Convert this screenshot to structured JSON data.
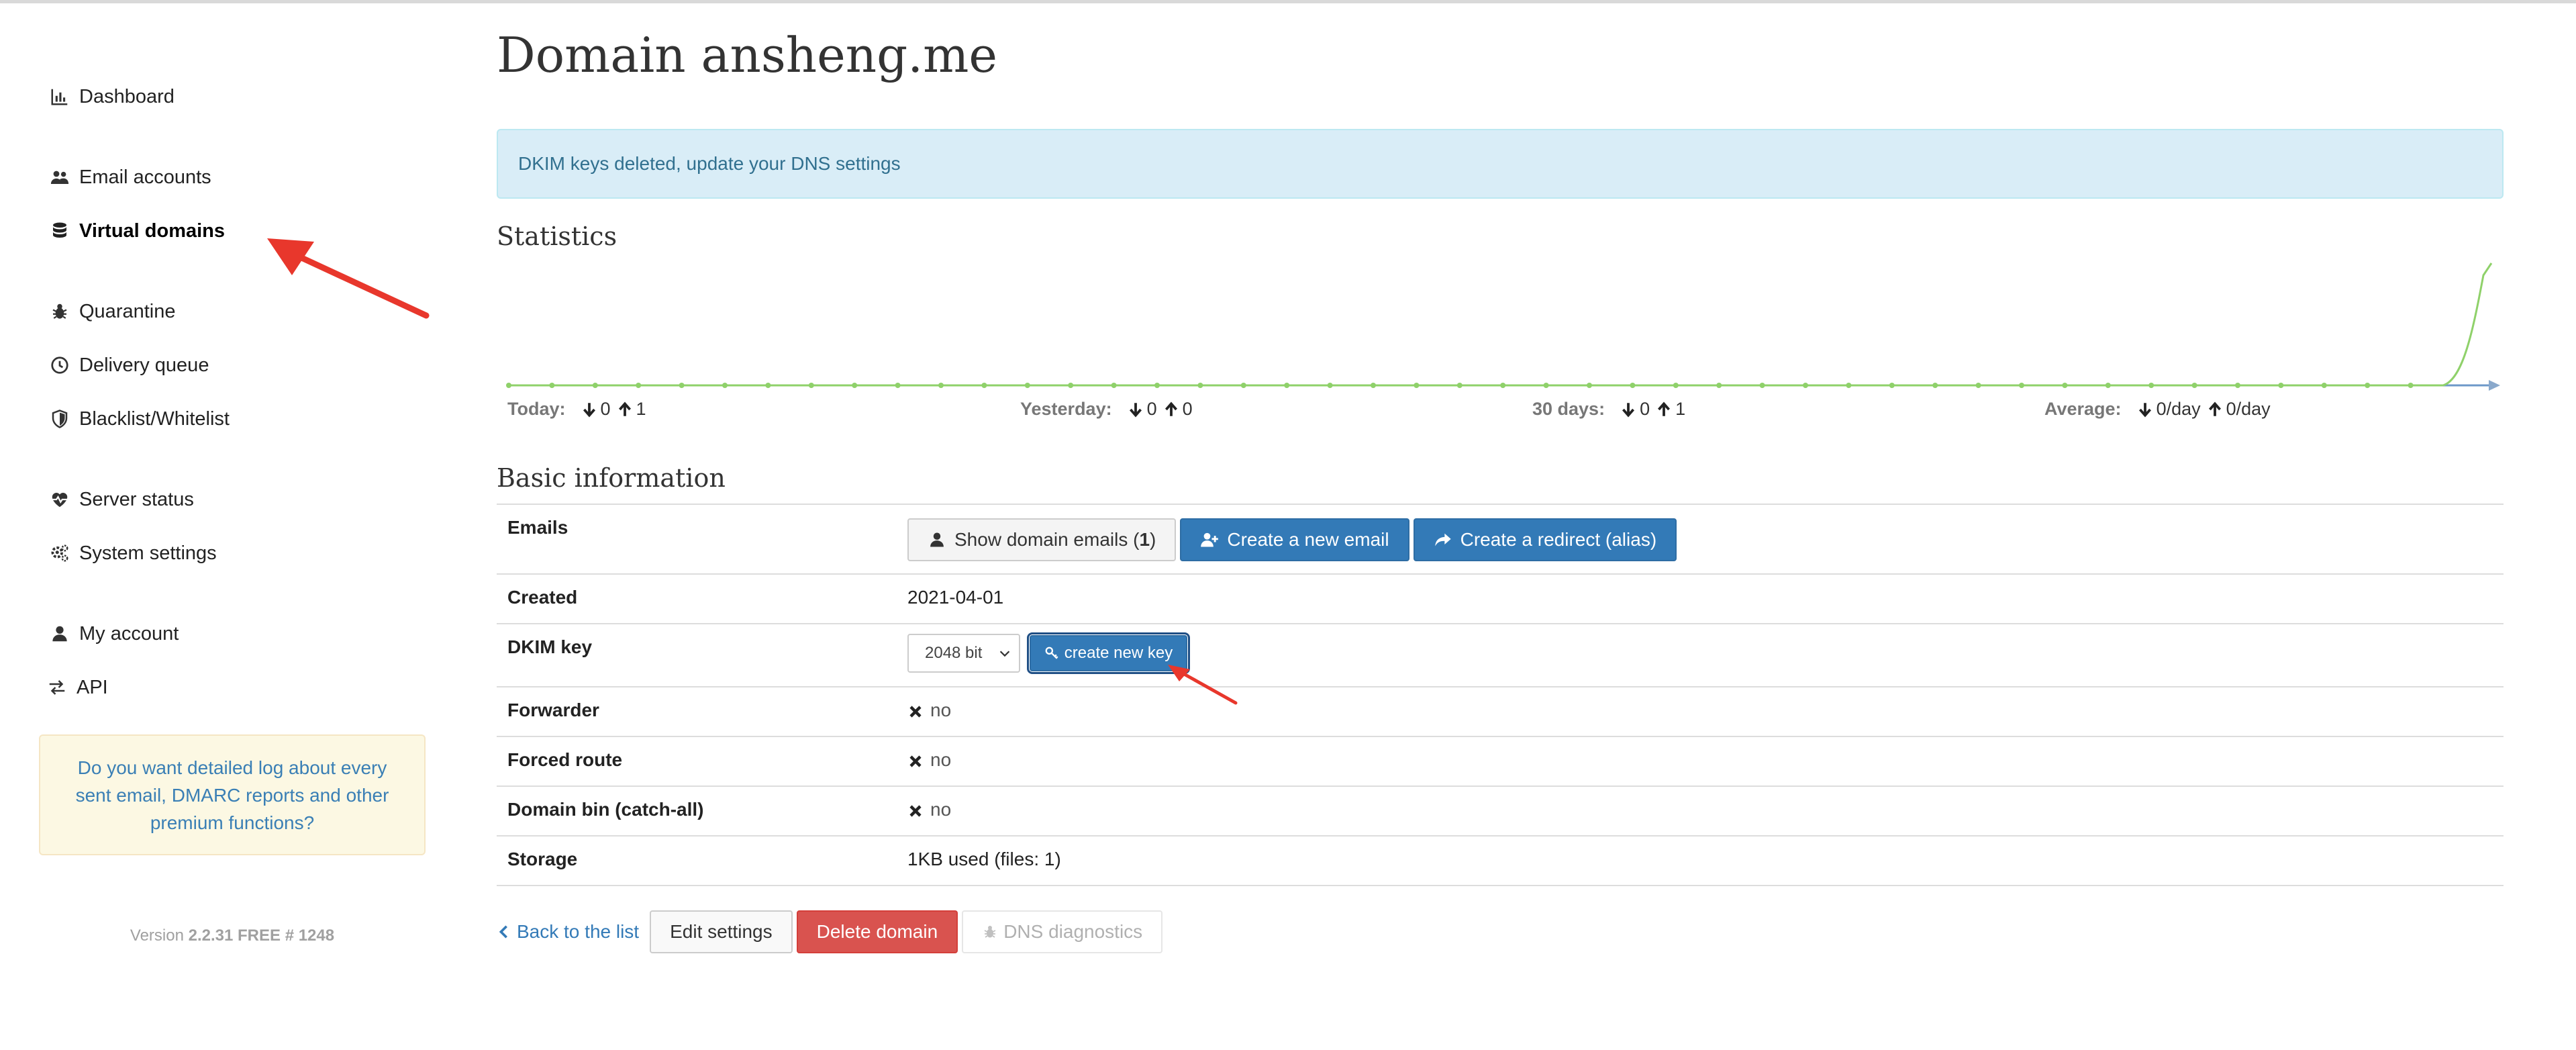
{
  "nav": {
    "dashboard": "Dashboard",
    "email_accounts": "Email accounts",
    "virtual_domains": "Virtual domains",
    "quarantine": "Quarantine",
    "delivery_queue": "Delivery queue",
    "blacklist": "Blacklist/Whitelist",
    "server_status": "Server status",
    "system_settings": "System settings",
    "my_account": "My account",
    "api": "API"
  },
  "promo": "Do you want detailed log about every sent email, DMARC reports and other premium functions?",
  "version": {
    "prefix": "Version",
    "value": "2.2.31 FREE # 1248"
  },
  "page_title": "Domain ansheng.me",
  "alert": "DKIM keys deleted, update your DNS settings",
  "statistics": {
    "title": "Statistics",
    "today": {
      "label": "Today:",
      "down": "0",
      "up": "1"
    },
    "yesterday": {
      "label": "Yesterday:",
      "down": "0",
      "up": "0"
    },
    "days30": {
      "label": "30 days:",
      "down": "0",
      "up": "1"
    },
    "average": {
      "label": "Average:",
      "down": "0/day",
      "up": "0/day"
    }
  },
  "basic": {
    "title": "Basic information",
    "emails_label": "Emails",
    "show_emails_text": "Show domain emails (",
    "show_emails_count": "1",
    "show_emails_close": ")",
    "create_email": "Create a new email",
    "create_redirect": "Create a redirect (alias)",
    "created_label": "Created",
    "created_value": "2021-04-01",
    "dkim_label": "DKIM key",
    "dkim_select": "2048 bit",
    "dkim_button": "create new key",
    "forwarder_label": "Forwarder",
    "forwarder_value": "no",
    "forced_route_label": "Forced route",
    "forced_route_value": "no",
    "domain_bin_label": "Domain bin (catch-all)",
    "domain_bin_value": "no",
    "storage_label": "Storage",
    "storage_value": "1KB used (files: 1)"
  },
  "actions": {
    "back": "Back to the list",
    "edit": "Edit settings",
    "delete": "Delete domain",
    "dns": "DNS diagnostics"
  },
  "colors": {
    "accent": "#337ab7",
    "danger": "#d9534f",
    "alert_bg": "#d9edf7",
    "promo_bg": "#fcf8e3",
    "chart_line": "#8fd16a",
    "annotation": "#e8372c"
  }
}
